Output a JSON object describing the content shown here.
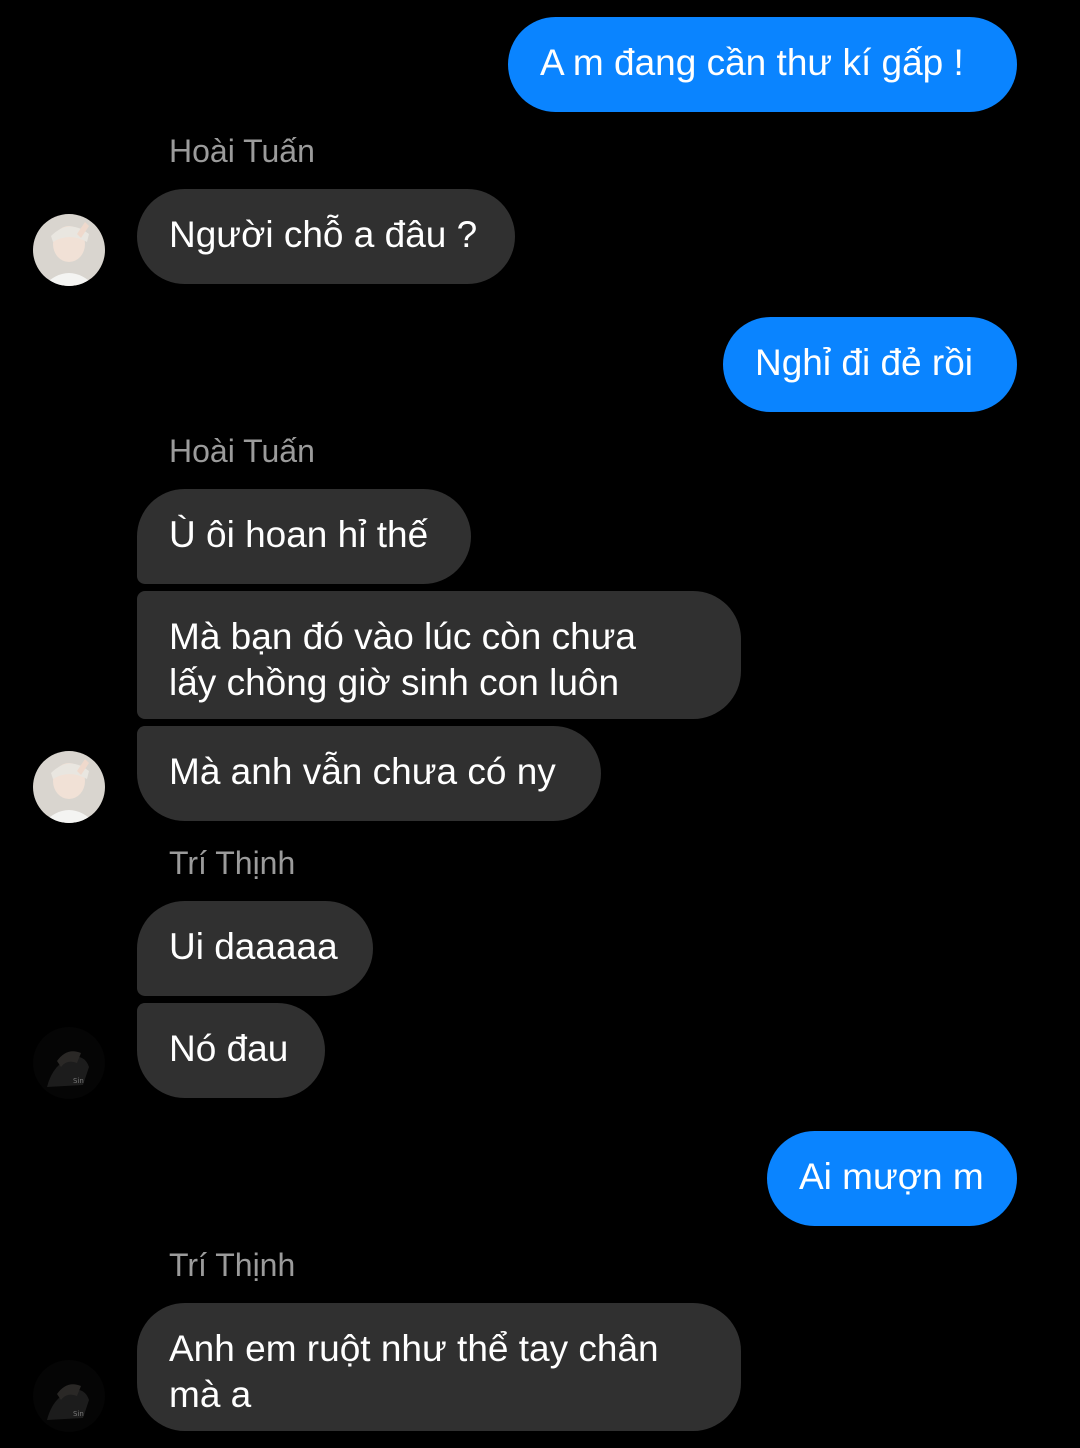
{
  "messages": {
    "m1": "A m đang cần thư kí gấp !",
    "n1": "Hoài Tuấn",
    "m2": "Người chỗ a đâu ?",
    "m3": "Nghỉ đi đẻ rồi",
    "n2": "Hoài Tuấn",
    "m4": "Ù ôi hoan hỉ thế",
    "m5": "Mà bạn đó vào lúc còn chưa\nlấy chồng giờ sinh con luôn",
    "m6": "Mà anh vẫn chưa có ny",
    "n3": "Trí Thịnh",
    "m7": "Ui daaaaa",
    "m8": "Nó đau",
    "m9": "Ai mượn m",
    "n4": "Trí Thịnh",
    "m10": "Anh em ruột như thể tay chân\nmà a"
  },
  "colors": {
    "outgoing_bubble": "#0a84ff",
    "incoming_bubble": "#303030",
    "background": "#000000",
    "sender_name": "#9b9b9b"
  }
}
